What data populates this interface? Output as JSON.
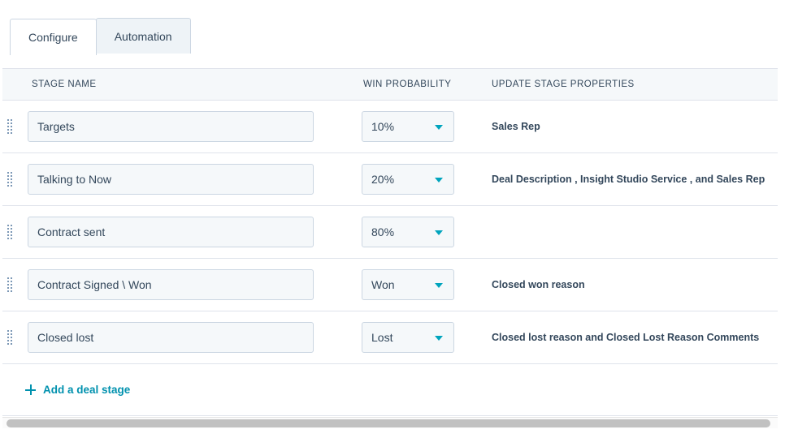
{
  "tabs": [
    {
      "label": "Configure",
      "active": true
    },
    {
      "label": "Automation",
      "active": false
    }
  ],
  "table": {
    "headers": {
      "stage_name": "STAGE NAME",
      "win_probability": "WIN PROBABILITY",
      "update_stage_properties": "UPDATE STAGE PROPERTIES"
    },
    "rows": [
      {
        "stage_name": "Targets",
        "win_probability": "10%",
        "update_stage_properties": "Sales Rep"
      },
      {
        "stage_name": "Talking to Now",
        "win_probability": "20%",
        "update_stage_properties": "Deal Description , Insight Studio Service , and Sales Rep"
      },
      {
        "stage_name": "Contract sent",
        "win_probability": "80%",
        "update_stage_properties": ""
      },
      {
        "stage_name": "Contract Signed \\ Won",
        "win_probability": "Won",
        "update_stage_properties": "Closed won reason"
      },
      {
        "stage_name": "Closed lost",
        "win_probability": "Lost",
        "update_stage_properties": "Closed lost reason and Closed Lost Reason Comments"
      }
    ]
  },
  "footer": {
    "add_stage_label": "Add a deal stage",
    "add_stage_icon": "plus-icon"
  },
  "icons": {
    "drag_handle": "drag-handle-icon",
    "dropdown_caret": "chevron-down-icon"
  },
  "colors": {
    "accent_link": "#0091ae",
    "accent_caret": "#00a4bd",
    "text_primary": "#33475b",
    "border": "#cbd6e2",
    "row_border": "#dfe3eb",
    "field_bg": "#f5f8fa",
    "header_bg": "#f5f8fa",
    "tab_inactive_bg": "#eef3f7"
  }
}
